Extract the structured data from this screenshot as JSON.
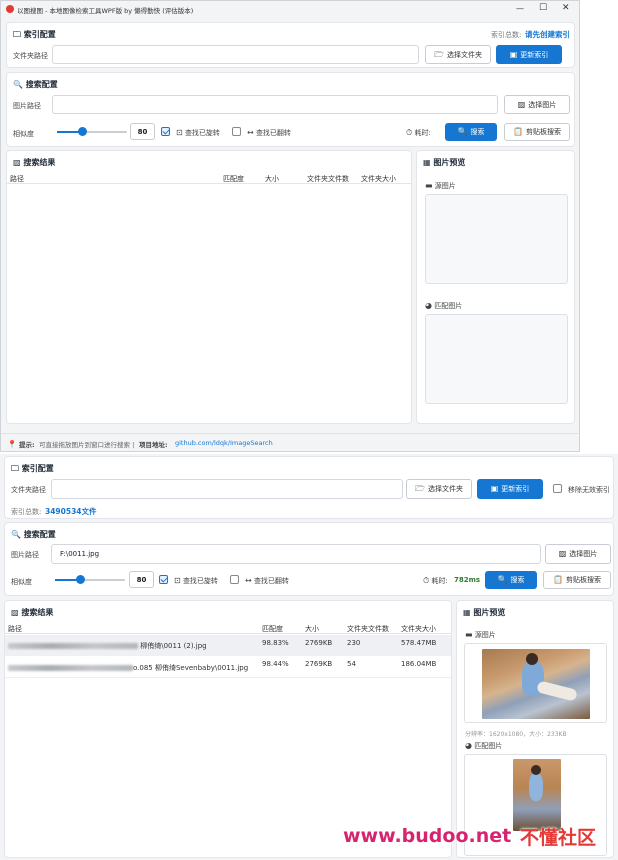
{
  "window": {
    "title": "以图搜图 - 本地图像检索工具WPF版 by 懒得勤快 (评估版本)",
    "logo_icon": "app-logo-icon"
  },
  "top": {
    "index": {
      "title": "索引配置",
      "count_label": "索引总数:",
      "count_value": "请先创建索引",
      "folder_label": "文件夹路径",
      "folder_value": "",
      "choose_folder": "选择文件夹",
      "update_index": "更新索引"
    },
    "search": {
      "title": "搜索配置",
      "image_label": "图片路径",
      "image_value": "",
      "choose_image": "选择图片",
      "similarity_label": "相似度",
      "similarity": 80,
      "rotate_label": "查找已旋转",
      "rotate_checked": true,
      "flip_label": "查找已翻转",
      "flip_checked": false,
      "elapsed_label": "耗时:",
      "elapsed_value": "",
      "search_btn": "搜索",
      "clipboard_btn": "剪贴板搜索"
    },
    "results": {
      "title": "搜索结果",
      "columns": [
        "路径",
        "匹配度",
        "大小",
        "文件夹文件数",
        "文件夹大小"
      ]
    },
    "preview": {
      "title": "图片预览",
      "source_label": "源图片",
      "match_label": "匹配图片"
    },
    "status": {
      "tip_label": "提示:",
      "tip_text": "可直接拖放图片到窗口进行搜索 |",
      "project_label": "项目地址:",
      "project_link": "github.com/ldqk/ImageSearch"
    }
  },
  "bottom": {
    "index": {
      "title": "索引配置",
      "folder_label": "文件夹路径",
      "folder_value": "",
      "choose_folder": "选择文件夹",
      "update_index": "更新索引",
      "remove_label": "移除无效索引",
      "remove_checked": false,
      "count_label": "索引总数:",
      "count_value": "3490534文件"
    },
    "search": {
      "title": "搜索配置",
      "image_label": "图片路径",
      "image_value": "F:\\0011.jpg",
      "choose_image": "选择图片",
      "similarity_label": "相似度",
      "similarity": 80,
      "rotate_label": "查找已旋转",
      "rotate_checked": true,
      "flip_label": "查找已翻转",
      "flip_checked": false,
      "elapsed_label": "耗时:",
      "elapsed_value": "782ms",
      "search_btn": "搜索",
      "clipboard_btn": "剪贴板搜索"
    },
    "results": {
      "title": "搜索结果",
      "columns": [
        "路径",
        "匹配度",
        "大小",
        "文件夹文件数",
        "文件夹大小"
      ],
      "rows": [
        {
          "path": "柳侑绮\\0011 (2).jpg",
          "match": "98.83%",
          "size": "2769KB",
          "files": "230",
          "folder_size": "578.47MB"
        },
        {
          "path": "o.085 柳侑绮Sevenbaby\\0011.jpg",
          "match": "98.44%",
          "size": "2769KB",
          "files": "54",
          "folder_size": "186.04MB"
        }
      ]
    },
    "preview": {
      "title": "图片预览",
      "source_label": "源图片",
      "resolution": "分辨率：1620x1080，大小：233KB",
      "match_label": "匹配图片"
    }
  },
  "watermark": {
    "left": "www.budoo.net",
    "right": "不懂社区"
  },
  "colors": {
    "accent": "#1677d2",
    "watermark_left": "#d6246e",
    "watermark_right": "#e53935"
  }
}
